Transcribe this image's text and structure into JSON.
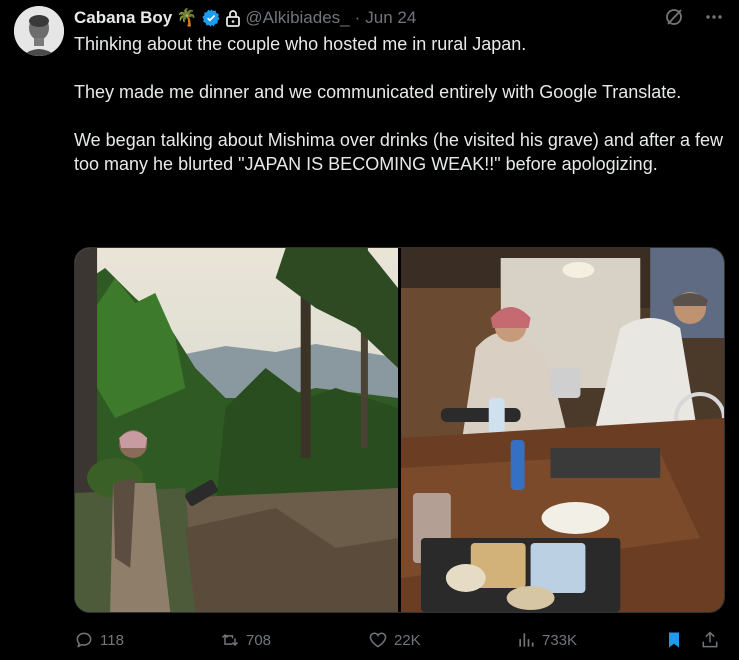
{
  "author": {
    "display_name": "Cabana Boy",
    "name_emoji": "🌴",
    "handle": "@Alkibiades_",
    "separator": "·",
    "date": "Jun 24"
  },
  "tweet": {
    "paragraphs": [
      "Thinking about the couple who hosted me in rural Japan.",
      "They made me dinner and we communicated entirely with Google Translate.",
      "We began talking about Mishima over drinks (he visited his grave) and after a few too many he blurted \"JAPAN IS BECOMING WEAK!!\" before apologizing."
    ]
  },
  "media": {
    "images": [
      {
        "icon": "forest-mountain-photo"
      },
      {
        "icon": "kitchen-dinner-photo"
      }
    ]
  },
  "actions": {
    "replies": "118",
    "reposts": "708",
    "likes": "22K",
    "views": "733K"
  },
  "colors": {
    "background": "#000000",
    "text": "#e7e9ea",
    "muted": "#71767b",
    "verified_blue": "#1d9bf0",
    "bookmark_blue": "#1d9bf0"
  }
}
